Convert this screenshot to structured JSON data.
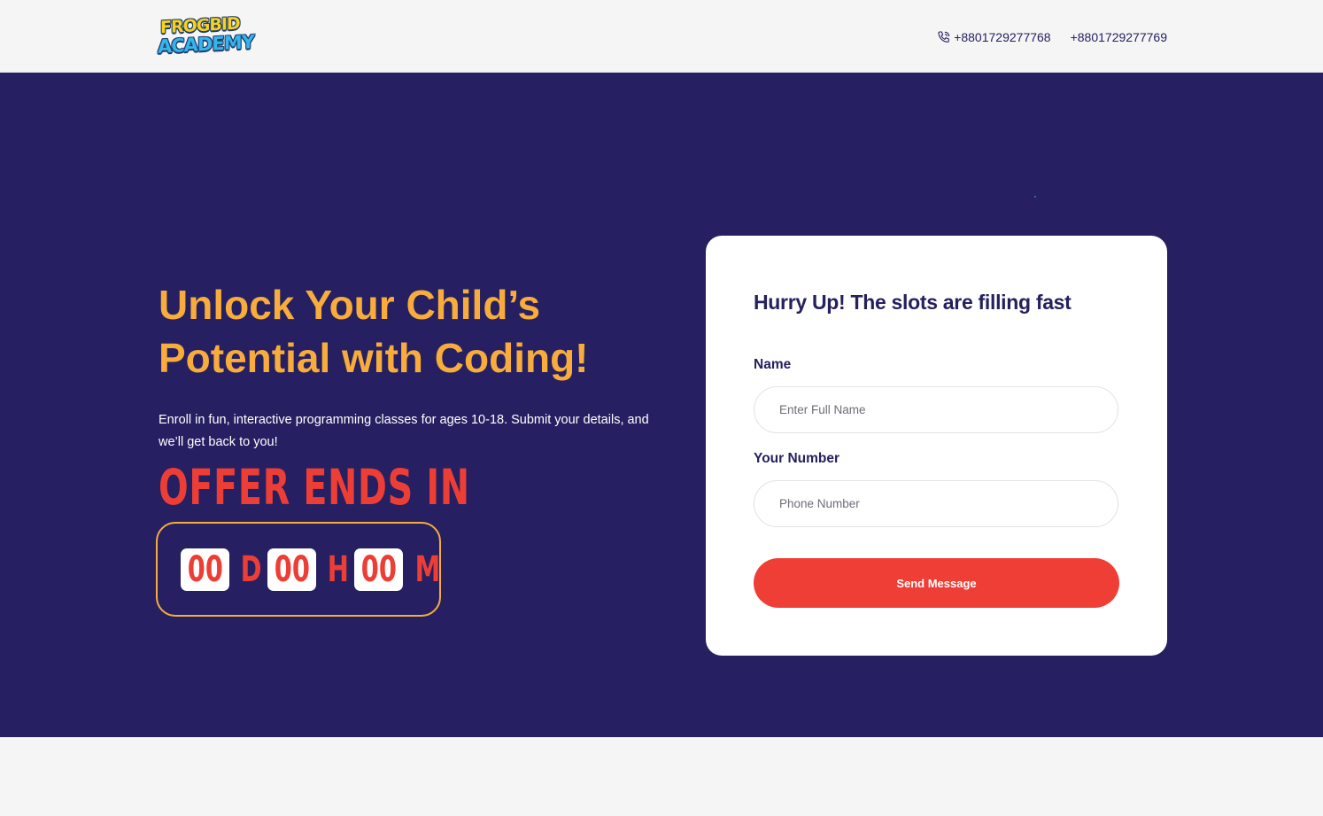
{
  "header": {
    "logo": {
      "line1": "FROGBID",
      "line2": "ACADEMY"
    },
    "phones": [
      "+8801729277768",
      "+8801729277769"
    ],
    "icons": {
      "phone": "phone-call-icon"
    }
  },
  "hero": {
    "headline": "Unlock Your Child’s Potential with Coding!",
    "subtext": "Enroll in fun, interactive programming classes for ages 10-18. Submit your details, and we’ll get back to you!",
    "offer_title": "OFFER ENDS IN",
    "countdown": {
      "days": "00",
      "days_unit": "D",
      "hours": "00",
      "hours_unit": "H",
      "minutes": "00",
      "minutes_unit": "M"
    }
  },
  "form": {
    "title": "Hurry Up! The slots are filling fast",
    "name_label": "Name",
    "name_placeholder": "Enter Full Name",
    "number_label": "Your Number",
    "number_placeholder": "Phone Number",
    "submit_label": "Send Message"
  },
  "colors": {
    "hero_bg": "#262062",
    "accent_orange": "#f7ac3b",
    "accent_red": "#ef3e36",
    "text_dark": "#25205e"
  }
}
